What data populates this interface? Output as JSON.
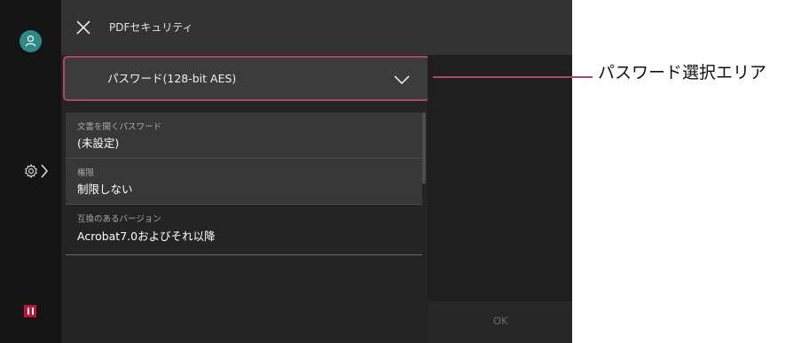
{
  "header": {
    "title": "PDFセキュリティ"
  },
  "dropdown": {
    "selected": "パスワード(128-bit AES)"
  },
  "settings": [
    {
      "label": "文書を開くパスワード",
      "value": "(未設定)"
    },
    {
      "label": "権限",
      "value": "制限しない"
    },
    {
      "label": "互換のあるバージョン",
      "value": "Acrobat7.0およびそれ以降"
    }
  ],
  "footer": {
    "ok_label": "OK"
  },
  "callout": {
    "text": "パスワード選択エリア"
  },
  "colors": {
    "accent": "#b0426e",
    "avatar": "#2a8a86",
    "pause": "#c1133a"
  },
  "icons": [
    "user-icon",
    "gear-icon",
    "chevron-right-icon",
    "close-icon",
    "chevron-down-icon",
    "pause-icon"
  ]
}
